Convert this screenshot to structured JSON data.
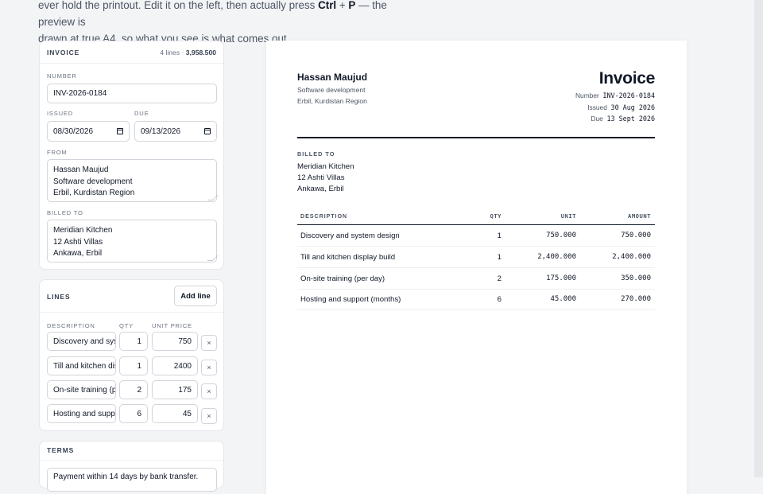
{
  "intro": {
    "line1_pre": "ever hold the printout. Edit it on the left, then actually press ",
    "key1": "Ctrl",
    "plus": " + ",
    "key2": "P",
    "line1_post": " — the preview is",
    "line2": "drawn at true A4, so what you see is what comes out."
  },
  "editor": {
    "invoice_card": {
      "title": "Invoice",
      "summary_lines": "4 lines · ",
      "summary_total": "3,958.500",
      "number_label": "Number",
      "number_value": "INV-2026-0184",
      "issued_label": "Issued",
      "issued_value": "08/30/2026",
      "due_label": "Due",
      "due_value": "09/13/2026",
      "from_label": "From",
      "from_value": "Hassan Maujud\nSoftware development\nErbil, Kurdistan Region",
      "billed_label": "Billed to",
      "billed_value": "Meridian Kitchen\n12 Ashti Villas\nAnkawa, Erbil"
    },
    "lines_card": {
      "title": "Lines",
      "add_button": "Add line",
      "col_description": "Description",
      "col_qty": "Qty",
      "col_unit_price": "Unit price",
      "remove_label": "×",
      "rows": [
        {
          "description": "Discovery and system design",
          "qty": "1",
          "unit_price": "750"
        },
        {
          "description": "Till and kitchen display build",
          "qty": "1",
          "unit_price": "2400"
        },
        {
          "description": "On-site training (per day)",
          "qty": "2",
          "unit_price": "175"
        },
        {
          "description": "Hosting and support (months)",
          "qty": "6",
          "unit_price": "45"
        }
      ]
    },
    "terms_card": {
      "title": "Terms",
      "value": "Payment within 14 days by bank transfer."
    }
  },
  "preview": {
    "from_name": "Hassan Maujud",
    "from_line1": "Software development",
    "from_line2": "Erbil, Kurdistan Region",
    "title": "Invoice",
    "number_label": "Number",
    "number_value": "INV-2026-0184",
    "issued_label": "Issued",
    "issued_value": "30 Aug 2026",
    "due_label": "Due",
    "due_value": "13 Sept 2026",
    "billed_label": "BILLED TO",
    "billed_name": "Meridian Kitchen",
    "billed_line1": "12 Ashti Villas",
    "billed_line2": "Ankawa, Erbil",
    "table": {
      "headers": {
        "description": "DESCRIPTION",
        "qty": "QTY",
        "unit": "UNIT",
        "amount": "AMOUNT"
      },
      "rows": [
        {
          "description": "Discovery and system design",
          "qty": "1",
          "unit": "750.000",
          "amount": "750.000"
        },
        {
          "description": "Till and kitchen display build",
          "qty": "1",
          "unit": "2,400.000",
          "amount": "2,400.000"
        },
        {
          "description": "On-site training (per day)",
          "qty": "2",
          "unit": "175.000",
          "amount": "350.000"
        },
        {
          "description": "Hosting and support (months)",
          "qty": "6",
          "unit": "45.000",
          "amount": "270.000"
        }
      ]
    }
  }
}
